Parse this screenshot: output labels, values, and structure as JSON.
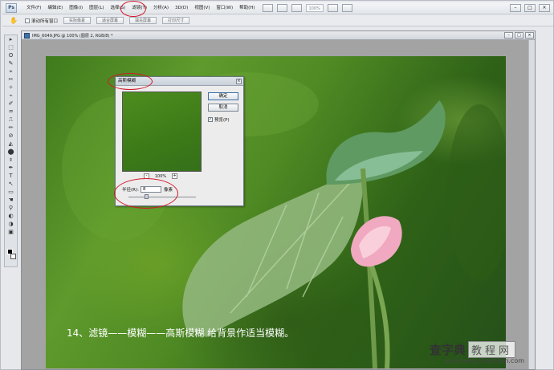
{
  "app": {
    "logo": "Ps"
  },
  "menubar": {
    "items": [
      "文件(F)",
      "编辑(E)",
      "图像(I)",
      "图层(L)",
      "选择(S)",
      "滤镜(T)",
      "分析(A)",
      "3D(D)",
      "视图(V)",
      "窗口(W)",
      "帮助(H)"
    ],
    "active_item": "滤镜(T)",
    "zoom_level": "100%",
    "window_controls": [
      "–",
      "□",
      "×"
    ]
  },
  "options_bar": {
    "tool_icon": "hand-icon",
    "resize_windows_label": "滚动所有窗口",
    "buttons": [
      "实际像素",
      "适合屏幕",
      "填充屏幕",
      "打印尺寸"
    ]
  },
  "tools": {
    "icons": [
      "▸",
      "⬚",
      "ʘ",
      "✎",
      "⌖",
      "✂",
      "✧",
      "⌁",
      "✐",
      "♒",
      "⎍",
      "✏",
      "⊘",
      "◭",
      "⬤",
      "⌽",
      "✒",
      "T",
      "↖",
      "▭",
      "☚",
      "⚲",
      "◐",
      "◑",
      "▣"
    ]
  },
  "document": {
    "title": "IMG_6049.JPG @ 100% (图层 2, RGB/8) *",
    "controls": [
      "–",
      "□",
      "×"
    ],
    "caption": "14、滤镜——模糊——高斯模糊      给背景作适当模糊。",
    "watermark_main": "查字典",
    "watermark_boxed": "教程网",
    "watermark_url": "jiaocheng.chazidian.com"
  },
  "dialog": {
    "title": "高斯模糊",
    "close": "×",
    "zoom_minus": "-",
    "zoom_percent": "100%",
    "zoom_plus": "+",
    "ok_label": "确定",
    "cancel_label": "取消",
    "preview_check": "✓",
    "preview_label": "预览(P)",
    "radius_label": "半径(R):",
    "radius_value": "8",
    "radius_unit": "像素",
    "radius_slider_fraction": 0.27
  },
  "annotation_color": "#d3172a"
}
